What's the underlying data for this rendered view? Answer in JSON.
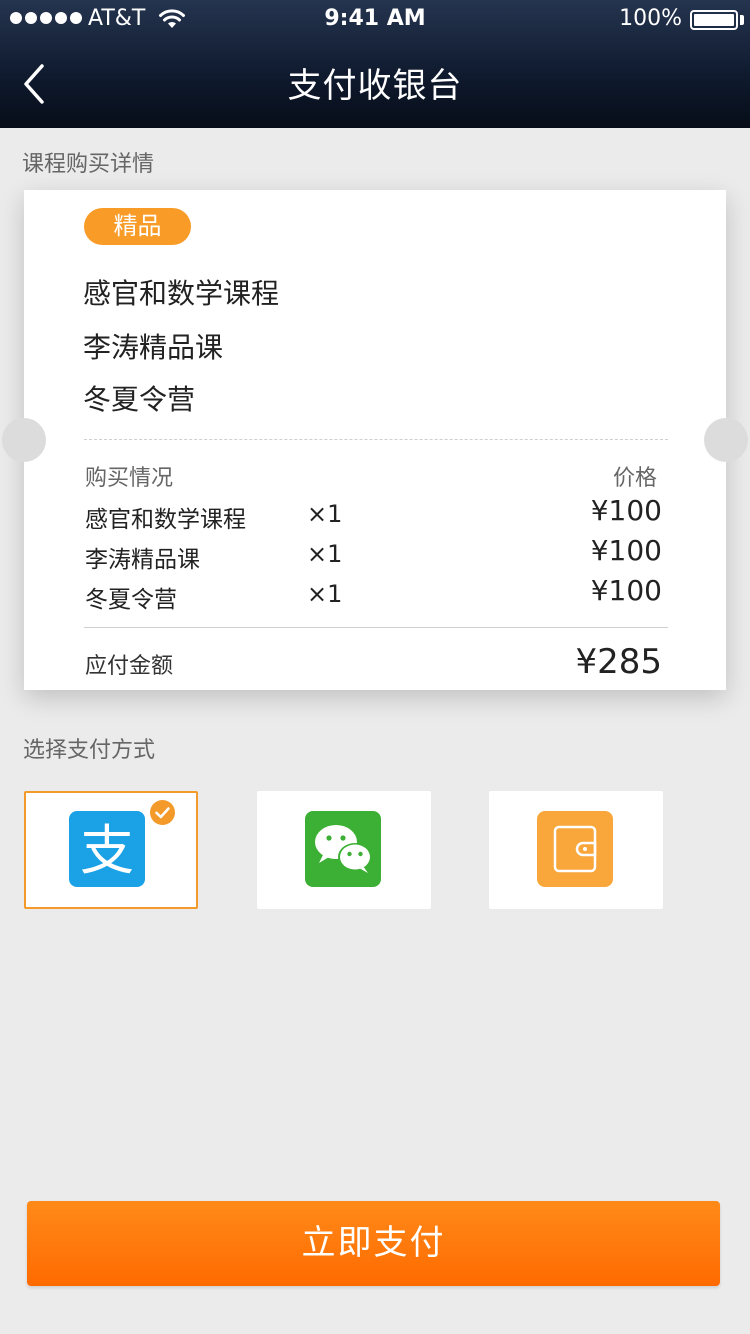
{
  "status_bar": {
    "carrier": "AT&T",
    "time": "9:41 AM",
    "battery": "100%"
  },
  "header": {
    "title": "支付收银台",
    "back_icon": "chevron-left-icon"
  },
  "details": {
    "section_label": "课程购买详情",
    "tag": "精品",
    "courses": [
      "感官和数学课程",
      "李涛精品课",
      "冬夏令营"
    ],
    "col_purchase": "购买情况",
    "col_price": "价格",
    "items": [
      {
        "name": "感官和数学课程",
        "qty": "×1",
        "price": "¥100"
      },
      {
        "name": "李涛精品课",
        "qty": "×1",
        "price": "¥100"
      },
      {
        "name": "冬夏令营",
        "qty": "×1",
        "price": "¥100"
      }
    ],
    "total_label": "应付金额",
    "total_amount": "¥285"
  },
  "payment": {
    "section_label": "选择支付方式",
    "options": [
      {
        "icon": "alipay-icon",
        "glyph": "支",
        "selected": true,
        "color": "#1aa1e6"
      },
      {
        "icon": "wechat-pay-icon",
        "selected": false,
        "color": "#3cb034"
      },
      {
        "icon": "wallet-icon",
        "selected": false,
        "color": "#f9a63b"
      }
    ],
    "accent_color": "#f39a2a"
  },
  "pay_button": {
    "label": "立即支付",
    "color": "#ff7a0a"
  }
}
